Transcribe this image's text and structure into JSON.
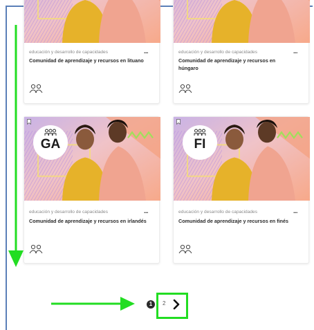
{
  "cards": [
    {
      "category": "educación y desarrollo de capacidades",
      "title": "Comunidad de aprendizaje y recursos en lituano",
      "more_label": "...",
      "people_icon": "people-icon"
    },
    {
      "category": "educación y desarrollo de capacidades",
      "title": "Comunidad de aprendizaje y recursos en húngaro",
      "more_label": "...",
      "people_icon": "people-icon"
    },
    {
      "badge": "GA",
      "category": "educación y desarrollo de capacidades",
      "title": "Comunidad de aprendizaje y recursos en irlandés",
      "more_label": "...",
      "people_icon": "people-icon"
    },
    {
      "badge": "FI",
      "category": "educación y desarrollo de capacidades",
      "title": "Comunidad de aprendizaje y recursos en finés",
      "more_label": "...",
      "people_icon": "people-icon"
    }
  ],
  "pagination": {
    "current_page": "1",
    "next_page": "2",
    "next_icon": "chevron-right-icon"
  },
  "annotations": {
    "color": "#22dd22"
  }
}
